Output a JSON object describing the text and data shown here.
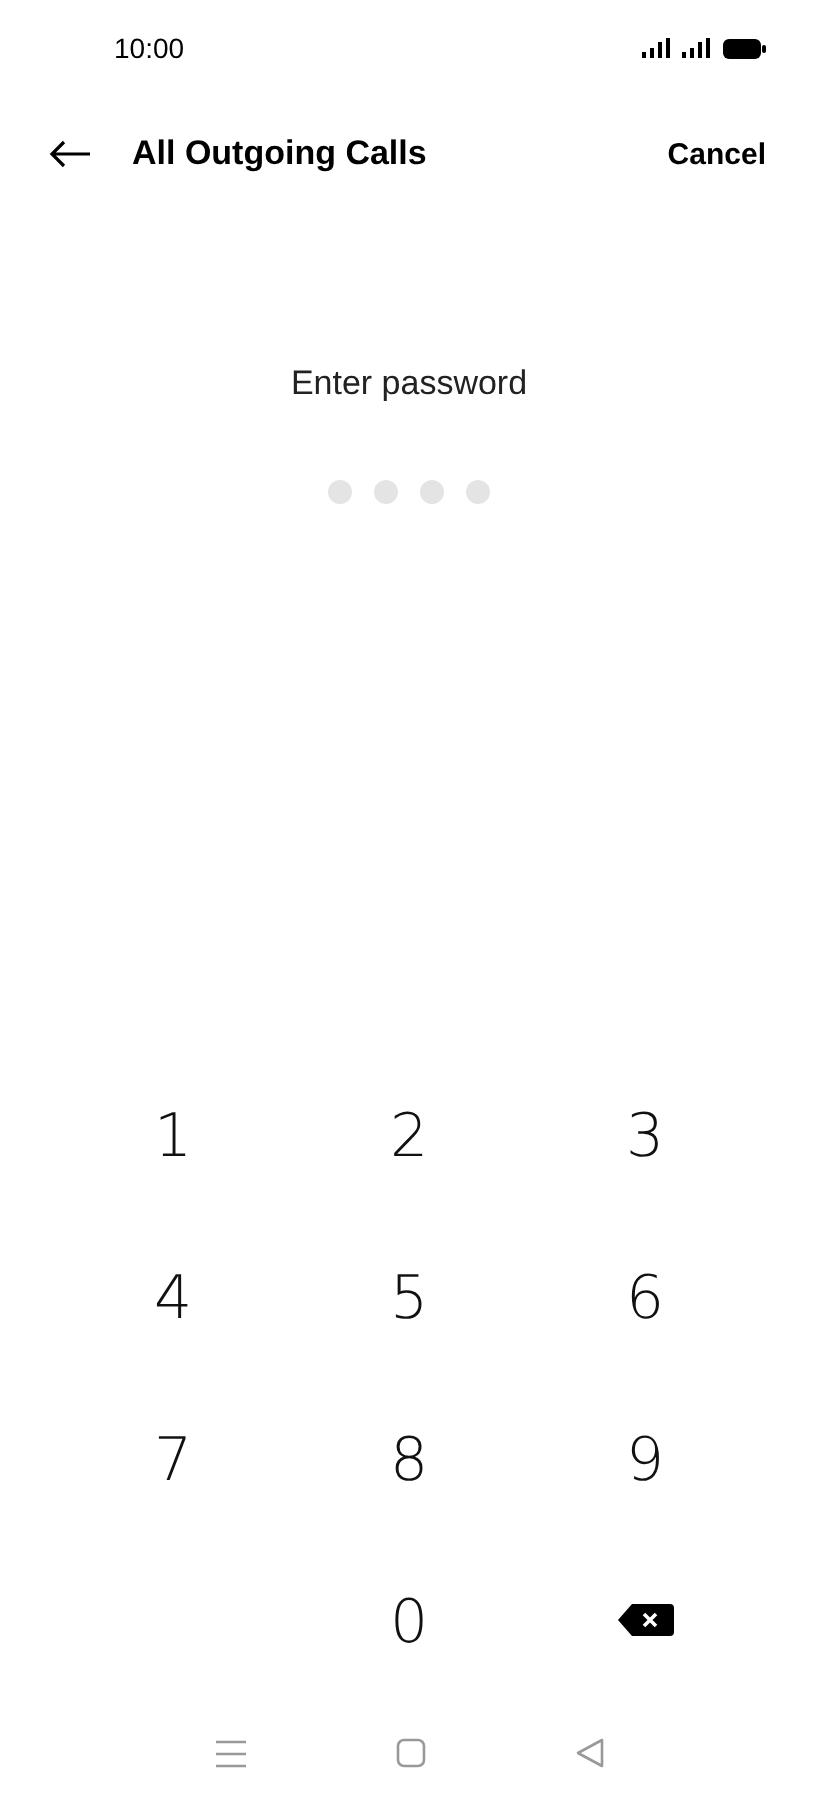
{
  "status_bar": {
    "time": "10:00"
  },
  "header": {
    "title": "All Outgoing Calls",
    "action": "Cancel"
  },
  "prompt": "Enter password",
  "pin_dots": [
    {
      "filled": false
    },
    {
      "filled": false
    },
    {
      "filled": false
    },
    {
      "filled": false
    }
  ],
  "keypad": [
    {
      "kind": "digit",
      "label": "1"
    },
    {
      "kind": "digit",
      "label": "2"
    },
    {
      "kind": "digit",
      "label": "3"
    },
    {
      "kind": "digit",
      "label": "4"
    },
    {
      "kind": "digit",
      "label": "5"
    },
    {
      "kind": "digit",
      "label": "6"
    },
    {
      "kind": "digit",
      "label": "7"
    },
    {
      "kind": "digit",
      "label": "8"
    },
    {
      "kind": "digit",
      "label": "9"
    },
    {
      "kind": "blank"
    },
    {
      "kind": "digit",
      "label": "0"
    },
    {
      "kind": "delete"
    }
  ]
}
